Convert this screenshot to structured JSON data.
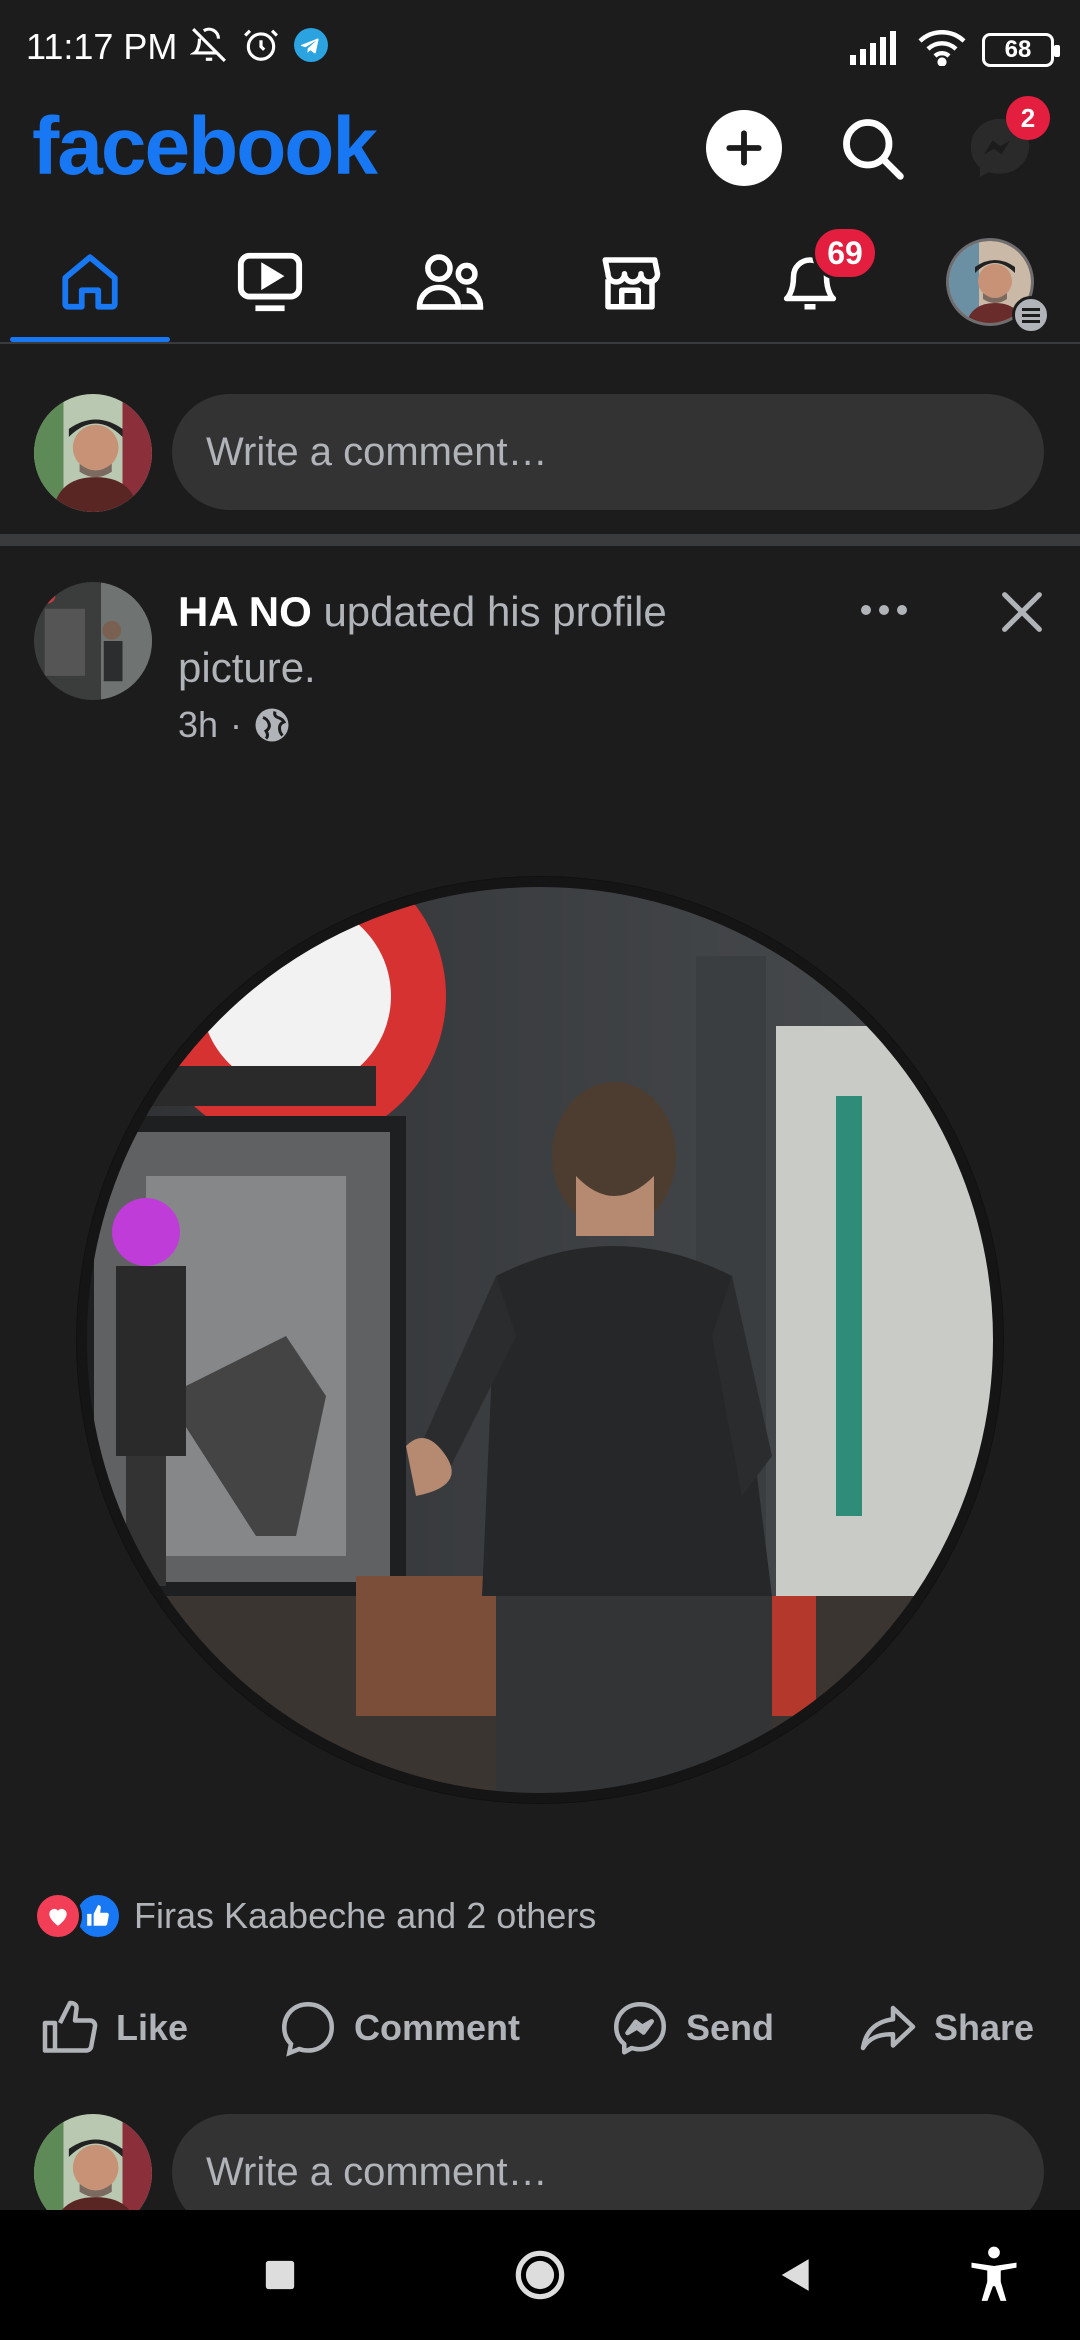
{
  "status_bar": {
    "time": "11:17 PM",
    "battery": "68"
  },
  "header": {
    "logo": "facebook",
    "messenger_badge": "2",
    "brand_color": "#1877f2"
  },
  "nav": {
    "tabs": [
      {
        "name": "home",
        "icon": "home-icon",
        "active": true
      },
      {
        "name": "watch",
        "icon": "video-icon",
        "active": false
      },
      {
        "name": "friends",
        "icon": "friends-icon",
        "active": false
      },
      {
        "name": "marketplace",
        "icon": "store-icon",
        "active": false
      },
      {
        "name": "notifications",
        "icon": "bell-icon",
        "active": false
      },
      {
        "name": "menu",
        "icon": "profile-avatar",
        "active": false
      }
    ],
    "notifications_badge": "69"
  },
  "composer": {
    "placeholder": "Write a comment…"
  },
  "post": {
    "author": "HA NO",
    "action_text": " updated his profile picture.",
    "time": "3h",
    "separator": "·",
    "audience_icon": "globe-icon",
    "reactions_text": "Firas Kaabeche and 2 others",
    "actions": {
      "like": "Like",
      "comment": "Comment",
      "send": "Send",
      "share": "Share"
    }
  },
  "composer2": {
    "placeholder": "Write a comment…"
  }
}
